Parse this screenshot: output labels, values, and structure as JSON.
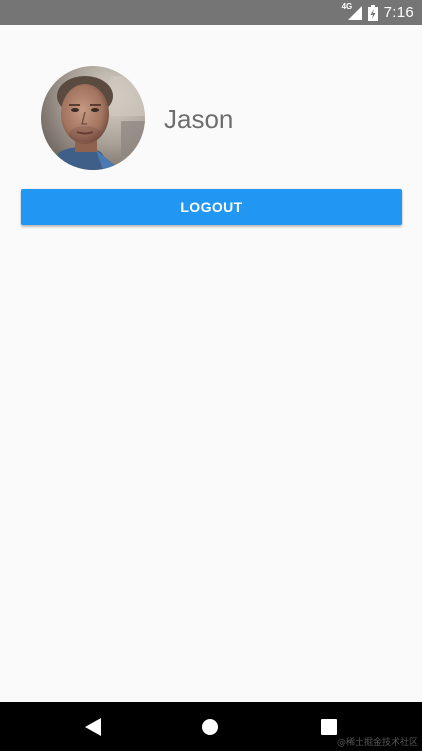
{
  "status_bar": {
    "network": "4G",
    "time": "7:16",
    "icons": [
      "signal-icon",
      "battery-charging-icon"
    ]
  },
  "profile": {
    "name": "Jason",
    "avatar_icon": "user-photo"
  },
  "logout_button": {
    "label": "LOGOUT"
  },
  "nav_bar": {
    "icons": [
      "back-icon",
      "home-icon",
      "recents-icon"
    ]
  },
  "watermark": "@稀土掘金技术社区",
  "colors": {
    "status_bar": "#757575",
    "background": "#fafafa",
    "primary": "#2196f3",
    "name_text": "#6d6d6d",
    "nav_bar": "#000000"
  }
}
